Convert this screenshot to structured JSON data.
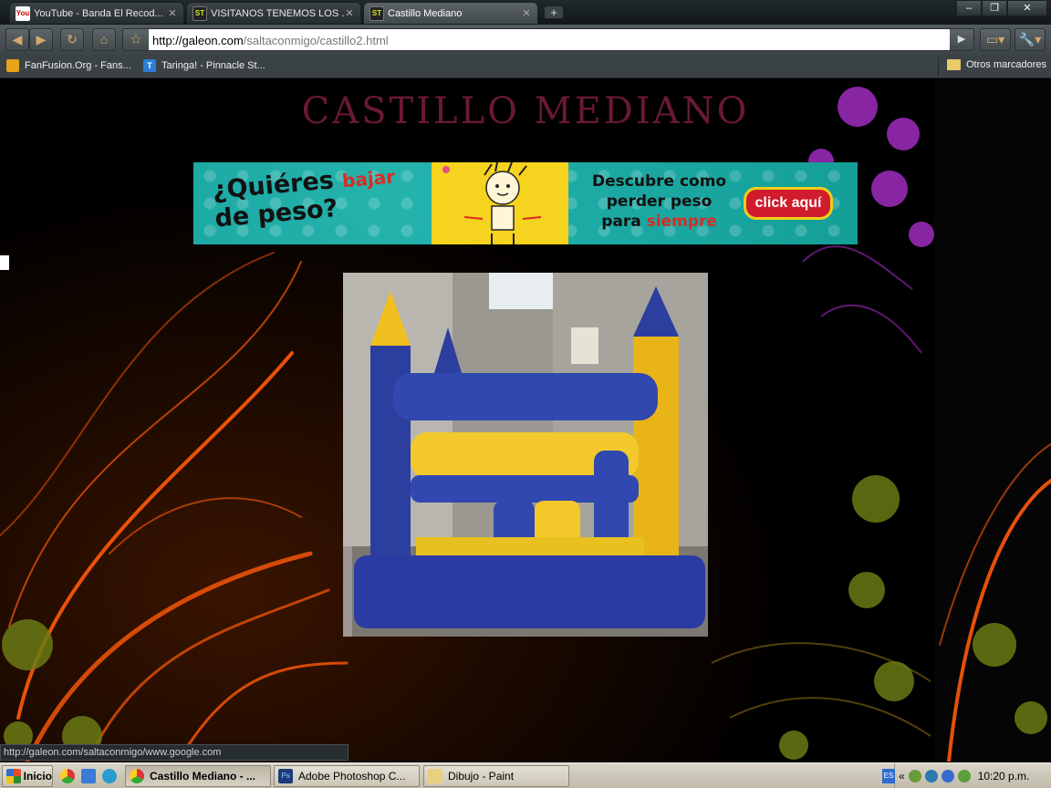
{
  "browser": {
    "tabs": [
      {
        "title": "YouTube - Banda El Recod...",
        "icon": "youtube-icon"
      },
      {
        "title": "VISITANOS TENEMOS LOS ...",
        "icon": "site-icon"
      },
      {
        "title": "Castillo Mediano",
        "icon": "site-icon",
        "active": true
      }
    ],
    "new_tab": "+",
    "window_controls": {
      "minimize": "–",
      "maximize": "❐",
      "close": "✕"
    },
    "url_host": "http://galeon.com",
    "url_path": "/saltaconmigo/castillo2.html",
    "bookmarks": [
      {
        "label": "FanFusion.Org - Fans..."
      },
      {
        "label": "Taringa! - Pinnacle St..."
      }
    ],
    "other_bookmarks": "Otros marcadores",
    "status_url": "http://galeon.com/saltaconmigo/www.google.com"
  },
  "page": {
    "title": "CASTILLO MEDIANO",
    "banner": {
      "question_part1": "¿Quiéres",
      "question_highlight": "bajar",
      "question_part2": "de peso?",
      "desc_line1": "Descubre como",
      "desc_line2": "perder peso",
      "desc_line3_prefix": "para",
      "desc_line3_highlight": "siempre",
      "cta": "click aquí"
    }
  },
  "taskbar": {
    "start_label": "Inicio",
    "tasks": [
      {
        "label": "Castillo Mediano - ...",
        "active": true
      },
      {
        "label": "Adobe Photoshop C..."
      },
      {
        "label": "Dibujo - Paint"
      }
    ],
    "language": "ES",
    "tray_chevron": "«",
    "clock": "10:20 p.m."
  },
  "colors": {
    "title": "#6a1838",
    "banner_teal": "#149e98",
    "banner_yellow": "#f6d31e",
    "cta_red": "#d01c2d",
    "swirl_orange": "#ff5a0a",
    "flower_purple": "#a02cc0",
    "flower_green": "#6a7a14"
  }
}
